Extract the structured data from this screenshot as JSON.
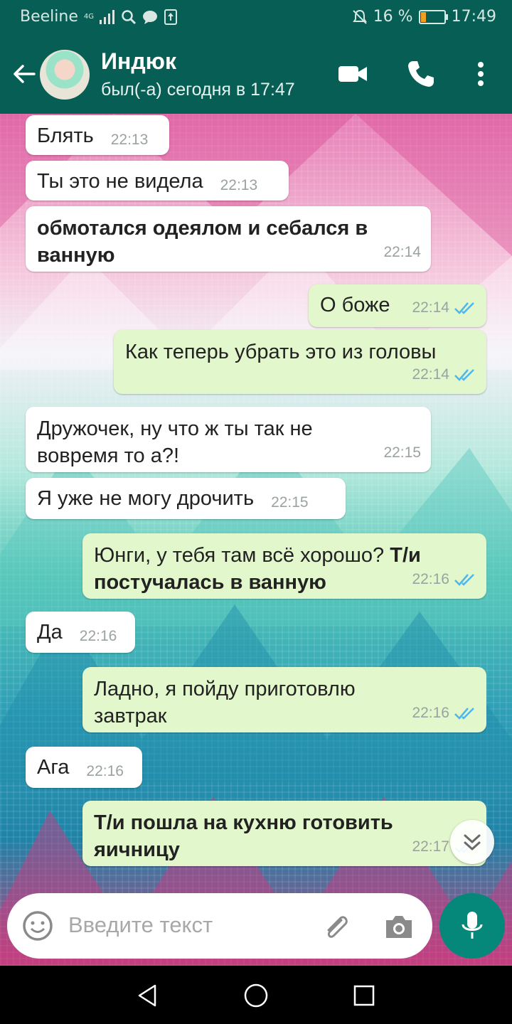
{
  "status_bar": {
    "carrier": "Beeline",
    "network": "4G",
    "battery": "16 %",
    "time": "17:49"
  },
  "header": {
    "contact_name": "Индюк",
    "last_seen": "был(-а) сегодня в 17:47"
  },
  "messages": [
    {
      "dir": "in",
      "text": "Блять",
      "time": "22:13"
    },
    {
      "dir": "in",
      "text": "Ты это не видела",
      "time": "22:13"
    },
    {
      "dir": "in",
      "text": "обмотался одеялом и себался в ванную",
      "bold": true,
      "time": "22:14"
    },
    {
      "dir": "out",
      "text": "О боже",
      "time": "22:14"
    },
    {
      "dir": "out",
      "text": "Как теперь убрать это из головы",
      "time": "22:14"
    },
    {
      "dir": "in",
      "text": "Дружочек, ну что ж ты так не вовремя то а?!",
      "time": "22:15"
    },
    {
      "dir": "in",
      "text": "Я уже не могу дрочить",
      "time": "22:15"
    },
    {
      "dir": "out",
      "text_plain": "Юнги, у тебя там всё хорошо?",
      "text_bold": "Т/и постучалась в ванную",
      "time": "22:16"
    },
    {
      "dir": "in",
      "text": "Да",
      "time": "22:16"
    },
    {
      "dir": "out",
      "text": "Ладно, я пойду приготовлю завтрак",
      "time": "22:16"
    },
    {
      "dir": "in",
      "text": "Ага",
      "time": "22:16"
    },
    {
      "dir": "out",
      "text": "Т/и пошла на кухню готовить яичницу",
      "bold": true,
      "time": "22:17"
    }
  ],
  "input": {
    "placeholder": "Введите текст"
  },
  "colors": {
    "header": "#075e54",
    "incoming_bubble": "#ffffff",
    "outgoing_bubble": "#e2f7cb",
    "read_tick": "#4fb6ec",
    "mic_button": "#05877a"
  }
}
